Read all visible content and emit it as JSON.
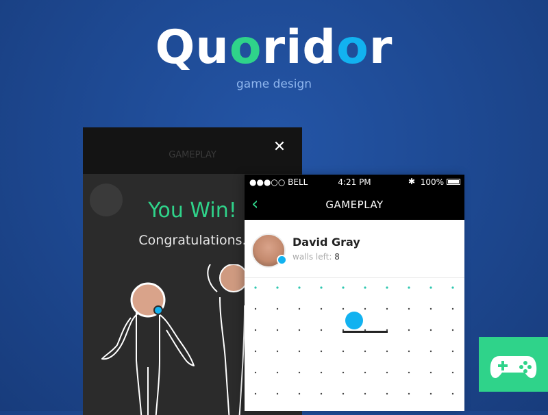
{
  "hero": {
    "title_parts": [
      "Qu",
      "o",
      "rid",
      "o",
      "r"
    ],
    "subtitle": "game design"
  },
  "win_screen": {
    "title": "You Win!",
    "message": "Congratulations.",
    "close_icon": "close-icon",
    "faded_header": "GAMEPLAY"
  },
  "status_bar": {
    "carrier": "●●●○○ BELL",
    "time": "4:21 PM",
    "battery": "100%"
  },
  "nav": {
    "title": "GAMEPLAY",
    "back_icon": "chevron-left-icon"
  },
  "player": {
    "name": "David Gray",
    "walls_label": "walls left:",
    "walls_value": "8"
  },
  "colors": {
    "accent_green": "#2fd38a",
    "accent_blue": "#12b2f0",
    "background": "#1e4a94"
  },
  "badge": {
    "icon": "gamepad-icon"
  }
}
